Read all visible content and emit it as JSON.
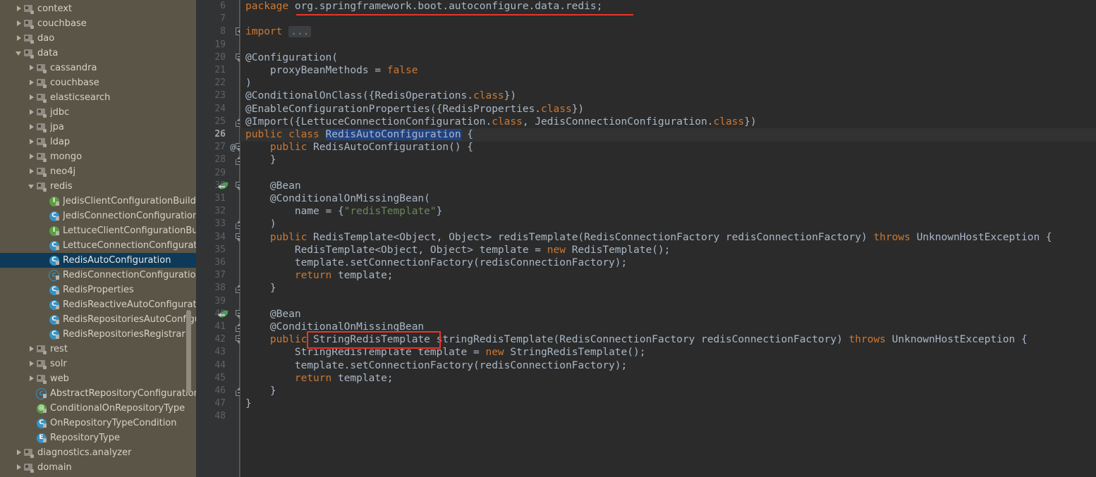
{
  "sidebar": {
    "background_color": "#5a5547",
    "selected_color": "#0d3a58",
    "scrollbar": {
      "visible": true
    },
    "items": [
      {
        "label": "context",
        "indent": 1,
        "arrow": "closed",
        "icon": "package-icon",
        "selected": false
      },
      {
        "label": "couchbase",
        "indent": 1,
        "arrow": "closed",
        "icon": "package-icon",
        "selected": false
      },
      {
        "label": "dao",
        "indent": 1,
        "arrow": "closed",
        "icon": "package-icon",
        "selected": false
      },
      {
        "label": "data",
        "indent": 1,
        "arrow": "open",
        "icon": "package-icon",
        "selected": false
      },
      {
        "label": "cassandra",
        "indent": 2,
        "arrow": "closed",
        "icon": "package-icon",
        "selected": false
      },
      {
        "label": "couchbase",
        "indent": 2,
        "arrow": "closed",
        "icon": "package-icon",
        "selected": false
      },
      {
        "label": "elasticsearch",
        "indent": 2,
        "arrow": "closed",
        "icon": "package-icon",
        "selected": false
      },
      {
        "label": "jdbc",
        "indent": 2,
        "arrow": "closed",
        "icon": "package-icon",
        "selected": false
      },
      {
        "label": "jpa",
        "indent": 2,
        "arrow": "closed",
        "icon": "package-icon",
        "selected": false
      },
      {
        "label": "ldap",
        "indent": 2,
        "arrow": "closed",
        "icon": "package-icon",
        "selected": false
      },
      {
        "label": "mongo",
        "indent": 2,
        "arrow": "closed",
        "icon": "package-icon",
        "selected": false
      },
      {
        "label": "neo4j",
        "indent": 2,
        "arrow": "closed",
        "icon": "package-icon",
        "selected": false
      },
      {
        "label": "redis",
        "indent": 2,
        "arrow": "open",
        "icon": "package-icon",
        "selected": false
      },
      {
        "label": "JedisClientConfigurationBuilderC",
        "indent": 3,
        "arrow": "none",
        "icon": "interface-icon",
        "selected": false
      },
      {
        "label": "JedisConnectionConfiguration",
        "indent": 3,
        "arrow": "none",
        "icon": "class-icon",
        "selected": false
      },
      {
        "label": "LettuceClientConfigurationBuilde",
        "indent": 3,
        "arrow": "none",
        "icon": "interface-icon",
        "selected": false
      },
      {
        "label": "LettuceConnectionConfiguration",
        "indent": 3,
        "arrow": "none",
        "icon": "class-icon",
        "selected": false
      },
      {
        "label": "RedisAutoConfiguration",
        "indent": 3,
        "arrow": "none",
        "icon": "class-icon",
        "selected": true
      },
      {
        "label": "RedisConnectionConfiguration",
        "indent": 3,
        "arrow": "none",
        "icon": "abstract-class-icon",
        "selected": false
      },
      {
        "label": "RedisProperties",
        "indent": 3,
        "arrow": "none",
        "icon": "class-icon",
        "selected": false
      },
      {
        "label": "RedisReactiveAutoConfiguration",
        "indent": 3,
        "arrow": "none",
        "icon": "class-icon",
        "selected": false
      },
      {
        "label": "RedisRepositoriesAutoConfigura",
        "indent": 3,
        "arrow": "none",
        "icon": "class-icon",
        "selected": false
      },
      {
        "label": "RedisRepositoriesRegistrar",
        "indent": 3,
        "arrow": "none",
        "icon": "class-icon",
        "selected": false
      },
      {
        "label": "rest",
        "indent": 2,
        "arrow": "closed",
        "icon": "package-icon",
        "selected": false
      },
      {
        "label": "solr",
        "indent": 2,
        "arrow": "closed",
        "icon": "package-icon",
        "selected": false
      },
      {
        "label": "web",
        "indent": 2,
        "arrow": "closed",
        "icon": "package-icon",
        "selected": false
      },
      {
        "label": "AbstractRepositoryConfigurationSc",
        "indent": 2,
        "arrow": "none",
        "icon": "abstract-class-icon",
        "selected": false
      },
      {
        "label": "ConditionalOnRepositoryType",
        "indent": 2,
        "arrow": "none",
        "icon": "annotation-icon",
        "selected": false
      },
      {
        "label": "OnRepositoryTypeCondition",
        "indent": 2,
        "arrow": "none",
        "icon": "class-icon",
        "selected": false
      },
      {
        "label": "RepositoryType",
        "indent": 2,
        "arrow": "none",
        "icon": "enum-icon",
        "selected": false
      },
      {
        "label": "diagnostics.analyzer",
        "indent": 1,
        "arrow": "closed",
        "icon": "package-icon",
        "selected": false
      },
      {
        "label": "domain",
        "indent": 1,
        "arrow": "closed",
        "icon": "package-icon",
        "selected": false
      }
    ]
  },
  "editor": {
    "background_color": "#2b2b2b",
    "gutter_color": "#313335",
    "current_line": 26,
    "lines": [
      {
        "num": 6,
        "marker": "",
        "bean": false,
        "fold": "",
        "tokens": [
          {
            "t": "package",
            "c": "kw"
          },
          {
            "t": " org.springframework.boot.autoconfigure.data.redis;",
            "c": "plain"
          }
        ]
      },
      {
        "num": 7,
        "marker": "",
        "bean": false,
        "fold": "",
        "tokens": []
      },
      {
        "num": 8,
        "marker": "",
        "bean": false,
        "fold": "plus",
        "tokens": [
          {
            "t": "import",
            "c": "kw"
          },
          {
            "t": " ",
            "c": "plain"
          },
          {
            "t": "...",
            "c": "fold"
          }
        ]
      },
      {
        "num": 19,
        "marker": "",
        "bean": false,
        "fold": "",
        "tokens": []
      },
      {
        "num": 20,
        "marker": "",
        "bean": false,
        "fold": "top",
        "tokens": [
          {
            "t": "@Configuration(",
            "c": "plain"
          }
        ]
      },
      {
        "num": 21,
        "marker": "",
        "bean": false,
        "fold": "",
        "tokens": [
          {
            "t": "    proxyBeanMethods = ",
            "c": "plain"
          },
          {
            "t": "false",
            "c": "kw"
          }
        ]
      },
      {
        "num": 22,
        "marker": "",
        "bean": false,
        "fold": "",
        "tokens": [
          {
            "t": ")",
            "c": "plain"
          }
        ]
      },
      {
        "num": 23,
        "marker": "",
        "bean": false,
        "fold": "",
        "tokens": [
          {
            "t": "@ConditionalOnClass({RedisOperations.",
            "c": "plain"
          },
          {
            "t": "class",
            "c": "kw"
          },
          {
            "t": "})",
            "c": "plain"
          }
        ]
      },
      {
        "num": 24,
        "marker": "",
        "bean": false,
        "fold": "",
        "tokens": [
          {
            "t": "@EnableConfigurationProperties({RedisProperties.",
            "c": "plain"
          },
          {
            "t": "class",
            "c": "kw"
          },
          {
            "t": "})",
            "c": "plain"
          }
        ]
      },
      {
        "num": 25,
        "marker": "",
        "bean": false,
        "fold": "bottom",
        "tokens": [
          {
            "t": "@Import({LettuceConnectionConfiguration.",
            "c": "plain"
          },
          {
            "t": "class",
            "c": "kw"
          },
          {
            "t": ", JedisConnectionConfiguration.",
            "c": "plain"
          },
          {
            "t": "class",
            "c": "kw"
          },
          {
            "t": "})",
            "c": "plain"
          }
        ]
      },
      {
        "num": 26,
        "marker": "",
        "bean": false,
        "fold": "",
        "tokens": [
          {
            "t": "public class",
            "c": "kw"
          },
          {
            "t": " ",
            "c": "plain"
          },
          {
            "t": "RedisAutoConfiguration",
            "c": "selname"
          },
          {
            "t": " {",
            "c": "plain"
          }
        ]
      },
      {
        "num": 27,
        "marker": "@",
        "bean": false,
        "fold": "top",
        "tokens": [
          {
            "t": "    ",
            "c": "plain"
          },
          {
            "t": "public",
            "c": "kw"
          },
          {
            "t": " RedisAutoConfiguration() {",
            "c": "plain"
          }
        ]
      },
      {
        "num": 28,
        "marker": "",
        "bean": false,
        "fold": "bottom",
        "tokens": [
          {
            "t": "    }",
            "c": "plain"
          }
        ]
      },
      {
        "num": 29,
        "marker": "",
        "bean": false,
        "fold": "",
        "tokens": []
      },
      {
        "num": 30,
        "marker": "",
        "bean": true,
        "fold": "top",
        "tokens": [
          {
            "t": "    @Bean",
            "c": "plain"
          }
        ]
      },
      {
        "num": 31,
        "marker": "",
        "bean": false,
        "fold": "",
        "tokens": [
          {
            "t": "    @ConditionalOnMissingBean(",
            "c": "plain"
          }
        ]
      },
      {
        "num": 32,
        "marker": "",
        "bean": false,
        "fold": "",
        "tokens": [
          {
            "t": "        name = {",
            "c": "plain"
          },
          {
            "t": "\"redisTemplate\"",
            "c": "str"
          },
          {
            "t": "}",
            "c": "plain"
          }
        ]
      },
      {
        "num": 33,
        "marker": "",
        "bean": false,
        "fold": "bottom",
        "tokens": [
          {
            "t": "    )",
            "c": "plain"
          }
        ]
      },
      {
        "num": 34,
        "marker": "",
        "bean": false,
        "fold": "top",
        "tokens": [
          {
            "t": "    ",
            "c": "plain"
          },
          {
            "t": "public",
            "c": "kw"
          },
          {
            "t": " RedisTemplate<Object, Object> redisTemplate(RedisConnectionFactory redisConnectionFactory) ",
            "c": "plain"
          },
          {
            "t": "throws",
            "c": "kw"
          },
          {
            "t": " UnknownHostException {",
            "c": "plain"
          }
        ]
      },
      {
        "num": 35,
        "marker": "",
        "bean": false,
        "fold": "",
        "tokens": [
          {
            "t": "        RedisTemplate<Object, Object> template = ",
            "c": "plain"
          },
          {
            "t": "new",
            "c": "kw"
          },
          {
            "t": " RedisTemplate();",
            "c": "plain"
          }
        ]
      },
      {
        "num": 36,
        "marker": "",
        "bean": false,
        "fold": "",
        "tokens": [
          {
            "t": "        template.setConnectionFactory(redisConnectionFactory);",
            "c": "plain"
          }
        ]
      },
      {
        "num": 37,
        "marker": "",
        "bean": false,
        "fold": "",
        "tokens": [
          {
            "t": "        ",
            "c": "plain"
          },
          {
            "t": "return",
            "c": "kw"
          },
          {
            "t": " template;",
            "c": "plain"
          }
        ]
      },
      {
        "num": 38,
        "marker": "",
        "bean": false,
        "fold": "bottom",
        "tokens": [
          {
            "t": "    }",
            "c": "plain"
          }
        ]
      },
      {
        "num": 39,
        "marker": "",
        "bean": false,
        "fold": "",
        "tokens": []
      },
      {
        "num": 40,
        "marker": "",
        "bean": true,
        "fold": "top",
        "tokens": [
          {
            "t": "    @Bean",
            "c": "plain"
          }
        ]
      },
      {
        "num": 41,
        "marker": "",
        "bean": false,
        "fold": "bottom",
        "tokens": [
          {
            "t": "    @ConditionalOnMissingBean",
            "c": "plain"
          }
        ]
      },
      {
        "num": 42,
        "marker": "",
        "bean": false,
        "fold": "top",
        "tokens": [
          {
            "t": "    ",
            "c": "plain"
          },
          {
            "t": "public",
            "c": "kw"
          },
          {
            "t": " StringRedisTemplate stringRedisTemplate(RedisConnectionFactory redisConnectionFactory) ",
            "c": "plain"
          },
          {
            "t": "throws",
            "c": "kw"
          },
          {
            "t": " UnknownHostException {",
            "c": "plain"
          }
        ]
      },
      {
        "num": 43,
        "marker": "",
        "bean": false,
        "fold": "",
        "tokens": [
          {
            "t": "        StringRedisTemplate template = ",
            "c": "plain"
          },
          {
            "t": "new",
            "c": "kw"
          },
          {
            "t": " StringRedisTemplate();",
            "c": "plain"
          }
        ]
      },
      {
        "num": 44,
        "marker": "",
        "bean": false,
        "fold": "",
        "tokens": [
          {
            "t": "        template.setConnectionFactory(redisConnectionFactory);",
            "c": "plain"
          }
        ]
      },
      {
        "num": 45,
        "marker": "",
        "bean": false,
        "fold": "",
        "tokens": [
          {
            "t": "        ",
            "c": "plain"
          },
          {
            "t": "return",
            "c": "kw"
          },
          {
            "t": " template;",
            "c": "plain"
          }
        ]
      },
      {
        "num": 46,
        "marker": "",
        "bean": false,
        "fold": "bottom",
        "tokens": [
          {
            "t": "    }",
            "c": "plain"
          }
        ]
      },
      {
        "num": 47,
        "marker": "",
        "bean": false,
        "fold": "",
        "tokens": [
          {
            "t": "}",
            "c": "plain"
          }
        ]
      },
      {
        "num": 48,
        "marker": "",
        "bean": false,
        "fold": "",
        "tokens": []
      }
    ]
  },
  "annotations": {
    "color": "#e8352c",
    "highlight_box": {
      "label": "StringRedisTemplate",
      "line": 42
    },
    "underline": {
      "label": "org.springframework.boot.autoconfigure.data.redis;",
      "line": 6
    }
  }
}
